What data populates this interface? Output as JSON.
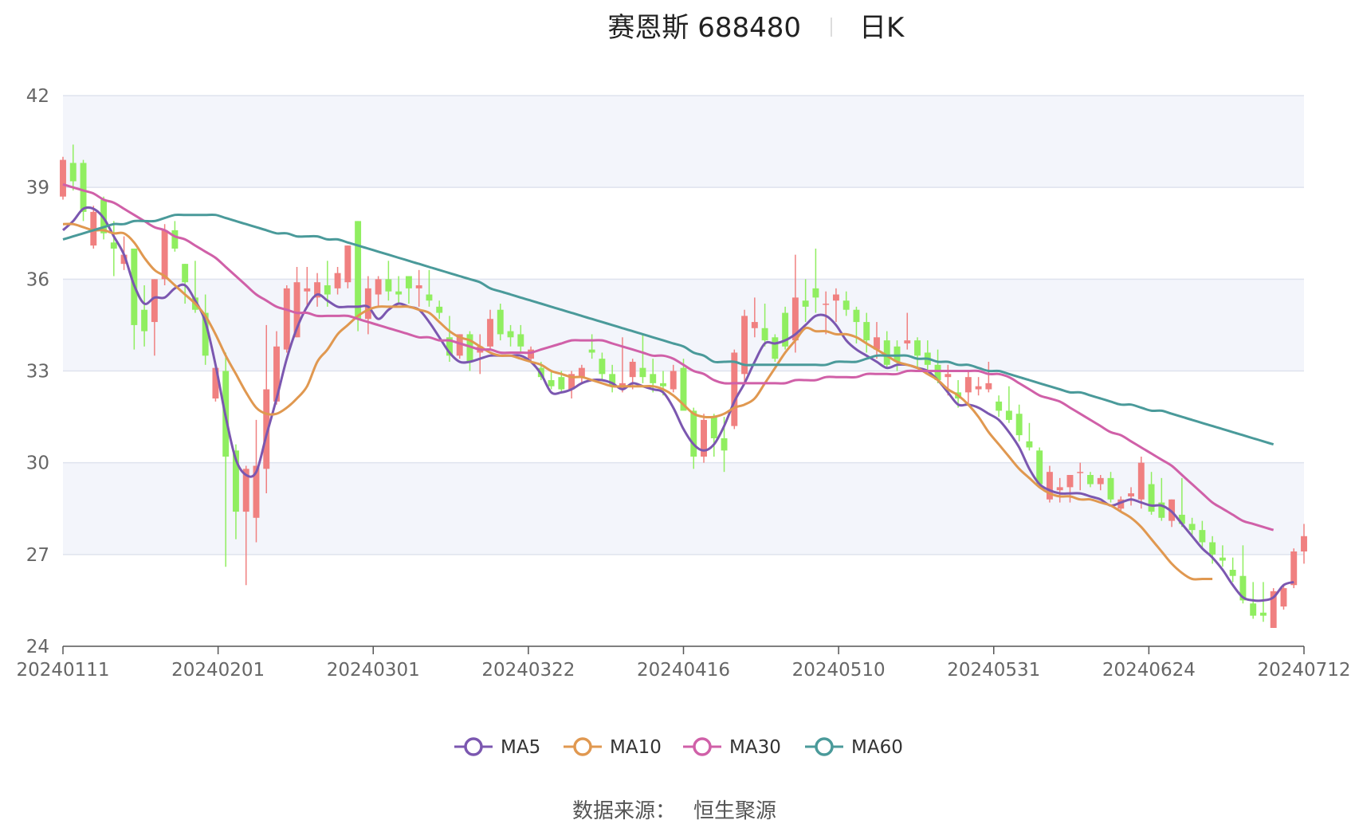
{
  "chart_data": {
    "type": "candlestick",
    "title": "赛恩斯 688480",
    "period_label": "日K",
    "source_label": "数据来源：",
    "source_name": "恒生聚源",
    "ylim": [
      24,
      42
    ],
    "yticks": [
      "24",
      "27",
      "30",
      "33",
      "36",
      "39",
      "42"
    ],
    "xtick_labels": [
      "20240111",
      "20240201",
      "20240301",
      "20240322",
      "20240416",
      "20240510",
      "20240531",
      "20240624",
      "20240712"
    ],
    "colors": {
      "up": "#f08080",
      "down": "#90ee60",
      "band": "#f3f5fb",
      "grid": "#dfe3ee",
      "axis": "#555555"
    },
    "ohlc": [
      [
        38.7,
        40.0,
        38.6,
        39.9
      ],
      [
        39.8,
        40.4,
        38.9,
        39.2
      ],
      [
        39.8,
        39.9,
        37.9,
        38.2
      ],
      [
        37.1,
        38.4,
        37.0,
        38.2
      ],
      [
        38.6,
        38.7,
        37.3,
        37.5
      ],
      [
        37.2,
        37.9,
        36.1,
        37.0
      ],
      [
        36.5,
        37.4,
        36.3,
        36.8
      ],
      [
        37.0,
        37.0,
        33.7,
        34.5
      ],
      [
        35.0,
        35.8,
        33.8,
        34.3
      ],
      [
        34.6,
        36.0,
        33.5,
        36.0
      ],
      [
        36.0,
        37.8,
        35.8,
        37.6
      ],
      [
        37.6,
        37.9,
        36.9,
        37.0
      ],
      [
        36.5,
        36.5,
        35.2,
        35.9
      ],
      [
        35.4,
        36.6,
        34.9,
        35.0
      ],
      [
        34.9,
        35.5,
        33.2,
        33.5
      ],
      [
        32.1,
        33.2,
        32.0,
        33.1
      ],
      [
        33.0,
        33.6,
        26.6,
        30.2
      ],
      [
        30.4,
        30.6,
        27.5,
        28.4
      ],
      [
        28.4,
        29.9,
        26.0,
        29.8
      ],
      [
        28.2,
        31.4,
        27.4,
        29.9
      ],
      [
        29.8,
        34.5,
        29.0,
        32.4
      ],
      [
        32.0,
        34.3,
        31.9,
        33.8
      ],
      [
        33.7,
        35.8,
        33.6,
        35.7
      ],
      [
        34.1,
        36.4,
        34.1,
        35.9
      ],
      [
        35.6,
        36.4,
        35.1,
        35.7
      ],
      [
        35.4,
        36.2,
        35.1,
        35.9
      ],
      [
        35.8,
        36.6,
        35.1,
        35.5
      ],
      [
        35.7,
        36.4,
        35.5,
        36.2
      ],
      [
        35.9,
        37.1,
        35.7,
        37.1
      ],
      [
        37.9,
        37.9,
        34.3,
        34.7
      ],
      [
        34.7,
        36.1,
        34.2,
        35.7
      ],
      [
        35.5,
        36.1,
        35.1,
        36.0
      ],
      [
        36.0,
        36.6,
        35.3,
        35.6
      ],
      [
        35.6,
        36.1,
        35.2,
        35.5
      ],
      [
        36.1,
        36.1,
        35.2,
        35.7
      ],
      [
        35.7,
        36.3,
        35.1,
        35.8
      ],
      [
        35.5,
        36.3,
        35.1,
        35.3
      ],
      [
        35.1,
        35.3,
        34.7,
        34.9
      ],
      [
        34.1,
        34.8,
        33.3,
        33.5
      ],
      [
        33.5,
        34.2,
        33.4,
        34.2
      ],
      [
        34.2,
        34.3,
        33.0,
        33.3
      ],
      [
        33.6,
        34.2,
        32.9,
        33.8
      ],
      [
        33.8,
        35.0,
        33.7,
        34.7
      ],
      [
        35.0,
        35.2,
        34.0,
        34.2
      ],
      [
        34.3,
        34.5,
        33.8,
        34.1
      ],
      [
        34.2,
        34.5,
        33.6,
        33.8
      ],
      [
        33.4,
        33.8,
        33.3,
        33.7
      ],
      [
        33.1,
        33.3,
        32.7,
        32.8
      ],
      [
        32.7,
        33.0,
        32.4,
        32.5
      ],
      [
        32.8,
        33.0,
        32.3,
        32.4
      ],
      [
        32.4,
        33.0,
        32.1,
        32.9
      ],
      [
        32.8,
        33.2,
        32.6,
        33.1
      ],
      [
        33.7,
        34.2,
        33.4,
        33.6
      ],
      [
        33.4,
        33.6,
        32.7,
        32.9
      ],
      [
        32.9,
        33.2,
        32.3,
        32.5
      ],
      [
        32.4,
        34.1,
        32.3,
        32.6
      ],
      [
        32.8,
        33.4,
        32.4,
        33.3
      ],
      [
        33.1,
        34.2,
        32.6,
        32.8
      ],
      [
        32.9,
        33.4,
        32.3,
        32.6
      ],
      [
        32.6,
        33.0,
        32.2,
        32.5
      ],
      [
        32.4,
        33.2,
        32.3,
        33.0
      ],
      [
        33.1,
        33.4,
        32.0,
        31.7
      ],
      [
        31.7,
        31.8,
        29.8,
        30.2
      ],
      [
        30.2,
        31.6,
        30.0,
        31.4
      ],
      [
        31.5,
        31.6,
        30.2,
        30.8
      ],
      [
        30.8,
        31.5,
        29.7,
        30.4
      ],
      [
        31.2,
        33.7,
        31.1,
        33.6
      ],
      [
        32.9,
        35.0,
        32.6,
        34.8
      ],
      [
        34.4,
        35.4,
        34.1,
        34.6
      ],
      [
        34.4,
        35.2,
        33.8,
        34.0
      ],
      [
        34.1,
        34.2,
        33.3,
        33.4
      ],
      [
        34.9,
        35.1,
        33.7,
        33.8
      ],
      [
        34.0,
        36.8,
        33.6,
        35.4
      ],
      [
        35.3,
        36.0,
        34.6,
        35.1
      ],
      [
        35.7,
        37.0,
        34.9,
        35.4
      ],
      [
        35.2,
        35.6,
        34.2,
        35.2
      ],
      [
        35.3,
        35.7,
        34.6,
        35.5
      ],
      [
        35.3,
        35.6,
        34.8,
        35.0
      ],
      [
        35.0,
        35.1,
        33.9,
        34.6
      ],
      [
        34.6,
        34.9,
        33.6,
        34.0
      ],
      [
        33.7,
        34.6,
        33.4,
        34.1
      ],
      [
        34.0,
        34.3,
        33.1,
        33.2
      ],
      [
        33.8,
        34.0,
        33.0,
        33.3
      ],
      [
        33.9,
        34.9,
        33.7,
        34.0
      ],
      [
        34.0,
        34.1,
        33.1,
        33.5
      ],
      [
        33.6,
        34.0,
        33.0,
        33.2
      ],
      [
        33.2,
        33.7,
        32.6,
        32.7
      ],
      [
        32.8,
        33.2,
        32.2,
        32.9
      ],
      [
        32.3,
        32.7,
        31.8,
        32.1
      ],
      [
        32.3,
        33.0,
        31.9,
        32.8
      ],
      [
        32.4,
        32.8,
        32.2,
        32.5
      ],
      [
        32.4,
        33.3,
        32.3,
        32.6
      ],
      [
        32.0,
        32.2,
        31.5,
        31.7
      ],
      [
        31.7,
        32.5,
        31.3,
        31.4
      ],
      [
        31.6,
        31.9,
        30.7,
        30.9
      ],
      [
        30.7,
        31.3,
        30.4,
        30.5
      ],
      [
        30.4,
        30.5,
        29.2,
        29.3
      ],
      [
        28.8,
        29.9,
        28.7,
        29.7
      ],
      [
        29.1,
        29.5,
        28.7,
        29.2
      ],
      [
        29.2,
        29.6,
        28.7,
        29.6
      ],
      [
        29.7,
        30.0,
        29.1,
        29.7
      ],
      [
        29.6,
        29.7,
        29.2,
        29.3
      ],
      [
        29.3,
        29.6,
        29.1,
        29.5
      ],
      [
        29.5,
        29.7,
        28.7,
        28.8
      ],
      [
        28.5,
        28.9,
        28.4,
        28.8
      ],
      [
        28.9,
        29.2,
        28.6,
        29.0
      ],
      [
        28.8,
        30.2,
        28.5,
        30.0
      ],
      [
        29.3,
        29.7,
        28.3,
        28.4
      ],
      [
        28.7,
        29.5,
        28.1,
        28.2
      ],
      [
        28.1,
        28.8,
        27.9,
        28.8
      ],
      [
        28.3,
        29.5,
        27.9,
        28.0
      ],
      [
        28.0,
        28.2,
        27.6,
        27.8
      ],
      [
        27.8,
        28.1,
        27.2,
        27.4
      ],
      [
        27.4,
        27.6,
        26.7,
        27.0
      ],
      [
        26.9,
        27.3,
        26.6,
        26.8
      ],
      [
        26.5,
        26.9,
        26.1,
        26.3
      ],
      [
        26.3,
        27.3,
        25.4,
        25.5
      ],
      [
        25.4,
        26.1,
        24.9,
        25.0
      ],
      [
        25.1,
        26.1,
        24.8,
        25.0
      ],
      [
        24.6,
        25.9,
        24.6,
        25.8
      ],
      [
        25.3,
        26.0,
        25.2,
        25.9
      ],
      [
        26.0,
        27.2,
        25.9,
        27.1
      ],
      [
        27.1,
        28.0,
        26.7,
        27.6
      ]
    ],
    "series": [
      {
        "name": "MA5",
        "color": "#7b57b0",
        "values": [
          37.6,
          37.9,
          38.3,
          38.3,
          38.0,
          37.4,
          36.8,
          35.8,
          35.2,
          35.4,
          35.4,
          35.7,
          35.8,
          35.3,
          34.6,
          33.2,
          31.5,
          30.1,
          29.6,
          29.7,
          30.9,
          32.1,
          33.4,
          34.4,
          35.1,
          35.5,
          35.3,
          35.1,
          35.1,
          35.1,
          35.1,
          34.7,
          35.0,
          35.2,
          35.1,
          35.0,
          34.6,
          34.1,
          33.6,
          33.3,
          33.3,
          33.4,
          33.5,
          33.5,
          33.5,
          33.5,
          33.3,
          32.9,
          32.3,
          32.3,
          32.4,
          32.6,
          32.7,
          32.7,
          32.6,
          32.4,
          32.6,
          32.5,
          32.4,
          32.3,
          31.8,
          31.1,
          30.6,
          30.4,
          30.6,
          31.2,
          32.0,
          32.6,
          33.3,
          33.9,
          33.9,
          34.0,
          34.2,
          34.5,
          34.8,
          34.8,
          34.5,
          34.0,
          33.7,
          33.5,
          33.3,
          33.1,
          33.2,
          33.2,
          33.1,
          33.0,
          32.7,
          32.3,
          31.9,
          31.9,
          31.8,
          31.6,
          31.4,
          31.0,
          30.5,
          29.8,
          29.3,
          29.1,
          29.0,
          29.0,
          29.0,
          28.9,
          28.8,
          28.6,
          28.7,
          28.8,
          28.7,
          28.6,
          28.6,
          28.4,
          28.0,
          27.6,
          27.2,
          26.9,
          26.5,
          26.0,
          25.6,
          25.5,
          25.5,
          25.6,
          26.0,
          26.1
        ]
      },
      {
        "name": "MA10",
        "color": "#e09850",
        "values": [
          37.8,
          37.8,
          37.7,
          37.6,
          37.6,
          37.5,
          37.5,
          37.2,
          36.7,
          36.3,
          36.1,
          35.8,
          35.5,
          35.2,
          34.8,
          34.2,
          33.5,
          32.9,
          32.3,
          31.8,
          31.6,
          31.6,
          31.8,
          32.1,
          32.5,
          33.3,
          33.7,
          34.2,
          34.5,
          34.8,
          35.0,
          35.1,
          35.1,
          35.1,
          35.1,
          35.0,
          34.9,
          34.6,
          34.3,
          34.1,
          34.0,
          33.8,
          33.6,
          33.5,
          33.5,
          33.4,
          33.3,
          33.2,
          33.0,
          32.9,
          32.8,
          32.8,
          32.7,
          32.6,
          32.5,
          32.5,
          32.5,
          32.5,
          32.5,
          32.4,
          32.2,
          31.9,
          31.6,
          31.5,
          31.5,
          31.6,
          31.8,
          31.9,
          32.1,
          32.6,
          33.1,
          33.6,
          34.0,
          34.4,
          34.3,
          34.3,
          34.2,
          34.2,
          34.1,
          33.9,
          33.7,
          33.5,
          33.3,
          33.2,
          33.1,
          32.9,
          32.7,
          32.4,
          32.2,
          31.9,
          31.5,
          31.0,
          30.6,
          30.2,
          29.8,
          29.5,
          29.2,
          29.0,
          28.9,
          28.9,
          28.8,
          28.8,
          28.7,
          28.6,
          28.4,
          28.2,
          27.9,
          27.5,
          27.1,
          26.7,
          26.4,
          26.2,
          26.2,
          26.2
        ]
      },
      {
        "name": "MA30",
        "color": "#d060a8",
        "values": [
          39.1,
          39.0,
          38.9,
          38.8,
          38.6,
          38.5,
          38.3,
          38.1,
          37.9,
          37.7,
          37.6,
          37.4,
          37.3,
          37.1,
          36.9,
          36.7,
          36.4,
          36.1,
          35.8,
          35.5,
          35.3,
          35.1,
          35.0,
          34.9,
          34.9,
          34.8,
          34.8,
          34.8,
          34.8,
          34.7,
          34.6,
          34.5,
          34.4,
          34.3,
          34.2,
          34.1,
          34.1,
          34.0,
          34.0,
          33.9,
          33.8,
          33.7,
          33.7,
          33.6,
          33.6,
          33.6,
          33.6,
          33.7,
          33.8,
          33.9,
          34.0,
          34.0,
          34.0,
          34.0,
          33.9,
          33.8,
          33.7,
          33.6,
          33.5,
          33.5,
          33.4,
          33.2,
          33.0,
          32.9,
          32.7,
          32.6,
          32.6,
          32.6,
          32.6,
          32.6,
          32.6,
          32.6,
          32.7,
          32.7,
          32.7,
          32.8,
          32.8,
          32.8,
          32.8,
          32.9,
          32.9,
          32.9,
          32.9,
          33.0,
          33.0,
          33.0,
          33.0,
          33.0,
          33.0,
          33.0,
          33.0,
          32.9,
          32.9,
          32.8,
          32.6,
          32.4,
          32.2,
          32.1,
          32.0,
          31.8,
          31.6,
          31.4,
          31.2,
          31.0,
          30.9,
          30.7,
          30.5,
          30.3,
          30.1,
          29.9,
          29.6,
          29.3,
          29.0,
          28.7,
          28.5,
          28.3,
          28.1,
          28.0,
          27.9,
          27.8
        ]
      },
      {
        "name": "MA60",
        "color": "#4a9a9a",
        "values": [
          37.3,
          37.4,
          37.5,
          37.6,
          37.7,
          37.8,
          37.8,
          37.9,
          37.9,
          37.9,
          38.0,
          38.1,
          38.1,
          38.1,
          38.1,
          38.1,
          38.0,
          37.9,
          37.8,
          37.7,
          37.6,
          37.5,
          37.5,
          37.4,
          37.4,
          37.4,
          37.3,
          37.3,
          37.2,
          37.1,
          37.0,
          36.9,
          36.8,
          36.7,
          36.6,
          36.5,
          36.4,
          36.3,
          36.2,
          36.1,
          36.0,
          35.9,
          35.7,
          35.6,
          35.5,
          35.4,
          35.3,
          35.2,
          35.1,
          35.0,
          34.9,
          34.8,
          34.7,
          34.6,
          34.5,
          34.4,
          34.3,
          34.2,
          34.1,
          34.0,
          33.9,
          33.8,
          33.6,
          33.5,
          33.3,
          33.3,
          33.3,
          33.2,
          33.2,
          33.2,
          33.2,
          33.2,
          33.2,
          33.2,
          33.2,
          33.2,
          33.3,
          33.3,
          33.3,
          33.4,
          33.5,
          33.5,
          33.5,
          33.5,
          33.4,
          33.4,
          33.3,
          33.3,
          33.2,
          33.2,
          33.1,
          33.0,
          33.0,
          32.9,
          32.8,
          32.7,
          32.6,
          32.5,
          32.4,
          32.3,
          32.3,
          32.2,
          32.1,
          32.0,
          31.9,
          31.9,
          31.8,
          31.7,
          31.7,
          31.6,
          31.5,
          31.4,
          31.3,
          31.2,
          31.1,
          31.0,
          30.9,
          30.8,
          30.7,
          30.6
        ]
      }
    ]
  }
}
